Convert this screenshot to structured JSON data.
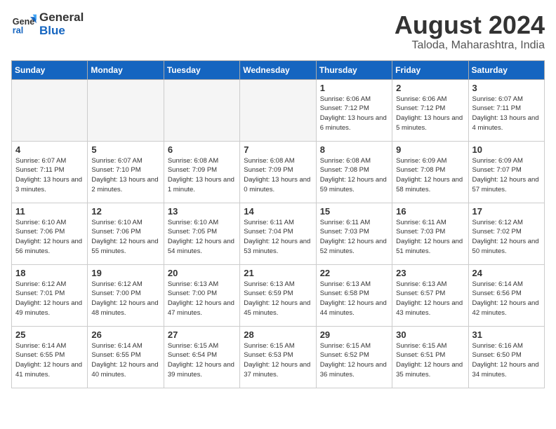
{
  "header": {
    "logo_line1": "General",
    "logo_line2": "Blue",
    "month_year": "August 2024",
    "location": "Taloda, Maharashtra, India"
  },
  "days_of_week": [
    "Sunday",
    "Monday",
    "Tuesday",
    "Wednesday",
    "Thursday",
    "Friday",
    "Saturday"
  ],
  "weeks": [
    [
      {
        "day": "",
        "empty": true
      },
      {
        "day": "",
        "empty": true
      },
      {
        "day": "",
        "empty": true
      },
      {
        "day": "",
        "empty": true
      },
      {
        "day": "1",
        "sunrise": "6:06 AM",
        "sunset": "7:12 PM",
        "daylight": "13 hours and 6 minutes."
      },
      {
        "day": "2",
        "sunrise": "6:06 AM",
        "sunset": "7:12 PM",
        "daylight": "13 hours and 5 minutes."
      },
      {
        "day": "3",
        "sunrise": "6:07 AM",
        "sunset": "7:11 PM",
        "daylight": "13 hours and 4 minutes."
      }
    ],
    [
      {
        "day": "4",
        "sunrise": "6:07 AM",
        "sunset": "7:11 PM",
        "daylight": "13 hours and 3 minutes."
      },
      {
        "day": "5",
        "sunrise": "6:07 AM",
        "sunset": "7:10 PM",
        "daylight": "13 hours and 2 minutes."
      },
      {
        "day": "6",
        "sunrise": "6:08 AM",
        "sunset": "7:09 PM",
        "daylight": "13 hours and 1 minute."
      },
      {
        "day": "7",
        "sunrise": "6:08 AM",
        "sunset": "7:09 PM",
        "daylight": "13 hours and 0 minutes."
      },
      {
        "day": "8",
        "sunrise": "6:08 AM",
        "sunset": "7:08 PM",
        "daylight": "12 hours and 59 minutes."
      },
      {
        "day": "9",
        "sunrise": "6:09 AM",
        "sunset": "7:08 PM",
        "daylight": "12 hours and 58 minutes."
      },
      {
        "day": "10",
        "sunrise": "6:09 AM",
        "sunset": "7:07 PM",
        "daylight": "12 hours and 57 minutes."
      }
    ],
    [
      {
        "day": "11",
        "sunrise": "6:10 AM",
        "sunset": "7:06 PM",
        "daylight": "12 hours and 56 minutes."
      },
      {
        "day": "12",
        "sunrise": "6:10 AM",
        "sunset": "7:06 PM",
        "daylight": "12 hours and 55 minutes."
      },
      {
        "day": "13",
        "sunrise": "6:10 AM",
        "sunset": "7:05 PM",
        "daylight": "12 hours and 54 minutes."
      },
      {
        "day": "14",
        "sunrise": "6:11 AM",
        "sunset": "7:04 PM",
        "daylight": "12 hours and 53 minutes."
      },
      {
        "day": "15",
        "sunrise": "6:11 AM",
        "sunset": "7:03 PM",
        "daylight": "12 hours and 52 minutes."
      },
      {
        "day": "16",
        "sunrise": "6:11 AM",
        "sunset": "7:03 PM",
        "daylight": "12 hours and 51 minutes."
      },
      {
        "day": "17",
        "sunrise": "6:12 AM",
        "sunset": "7:02 PM",
        "daylight": "12 hours and 50 minutes."
      }
    ],
    [
      {
        "day": "18",
        "sunrise": "6:12 AM",
        "sunset": "7:01 PM",
        "daylight": "12 hours and 49 minutes."
      },
      {
        "day": "19",
        "sunrise": "6:12 AM",
        "sunset": "7:00 PM",
        "daylight": "12 hours and 48 minutes."
      },
      {
        "day": "20",
        "sunrise": "6:13 AM",
        "sunset": "7:00 PM",
        "daylight": "12 hours and 47 minutes."
      },
      {
        "day": "21",
        "sunrise": "6:13 AM",
        "sunset": "6:59 PM",
        "daylight": "12 hours and 45 minutes."
      },
      {
        "day": "22",
        "sunrise": "6:13 AM",
        "sunset": "6:58 PM",
        "daylight": "12 hours and 44 minutes."
      },
      {
        "day": "23",
        "sunrise": "6:13 AM",
        "sunset": "6:57 PM",
        "daylight": "12 hours and 43 minutes."
      },
      {
        "day": "24",
        "sunrise": "6:14 AM",
        "sunset": "6:56 PM",
        "daylight": "12 hours and 42 minutes."
      }
    ],
    [
      {
        "day": "25",
        "sunrise": "6:14 AM",
        "sunset": "6:55 PM",
        "daylight": "12 hours and 41 minutes."
      },
      {
        "day": "26",
        "sunrise": "6:14 AM",
        "sunset": "6:55 PM",
        "daylight": "12 hours and 40 minutes."
      },
      {
        "day": "27",
        "sunrise": "6:15 AM",
        "sunset": "6:54 PM",
        "daylight": "12 hours and 39 minutes."
      },
      {
        "day": "28",
        "sunrise": "6:15 AM",
        "sunset": "6:53 PM",
        "daylight": "12 hours and 37 minutes."
      },
      {
        "day": "29",
        "sunrise": "6:15 AM",
        "sunset": "6:52 PM",
        "daylight": "12 hours and 36 minutes."
      },
      {
        "day": "30",
        "sunrise": "6:15 AM",
        "sunset": "6:51 PM",
        "daylight": "12 hours and 35 minutes."
      },
      {
        "day": "31",
        "sunrise": "6:16 AM",
        "sunset": "6:50 PM",
        "daylight": "12 hours and 34 minutes."
      }
    ]
  ]
}
